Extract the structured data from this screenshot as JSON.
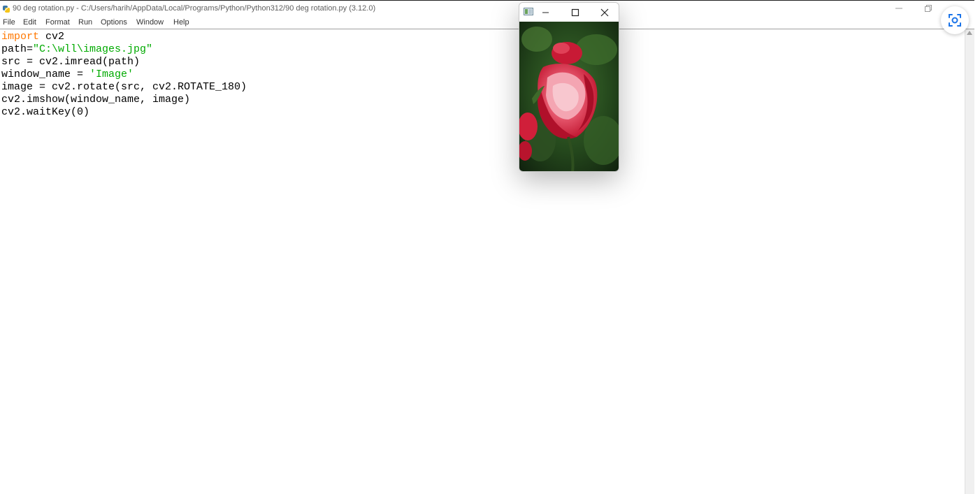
{
  "window": {
    "title": "90 deg rotation.py - C:/Users/harih/AppData/Local/Programs/Python/Python312/90 deg rotation.py (3.12.0)",
    "icons": {
      "app": "python-idle-icon",
      "minimize": "minimize-icon",
      "restore": "restore-icon",
      "close": "close-icon"
    }
  },
  "menu": {
    "items": [
      "File",
      "Edit",
      "Format",
      "Run",
      "Options",
      "Window",
      "Help"
    ]
  },
  "editor": {
    "lines": [
      {
        "kw": "import",
        "rest": " cv2"
      },
      {
        "pre": "path=",
        "str": "\"C:\\wll\\images.jpg\""
      },
      {
        "text": "src = cv2.imread(path)"
      },
      {
        "pre": "window_name = ",
        "str": "'Image'"
      },
      {
        "text": "image = cv2.rotate(src, cv2.ROTATE_180)"
      },
      {
        "text": "cv2.imshow(window_name, image)"
      },
      {
        "text": "cv2.waitKey(0)"
      }
    ],
    "colors": {
      "keyword": "#ff7700",
      "string": "#00aa00",
      "default": "#000000"
    }
  },
  "image_window": {
    "icons": {
      "app": "opencv-window-icon",
      "minimize": "minimize-icon",
      "maximize": "maximize-icon",
      "close": "close-icon"
    },
    "content": "red-rose-photo"
  },
  "overlay": {
    "lens_icon": "visual-search-icon",
    "accent": "#1a73e8"
  }
}
